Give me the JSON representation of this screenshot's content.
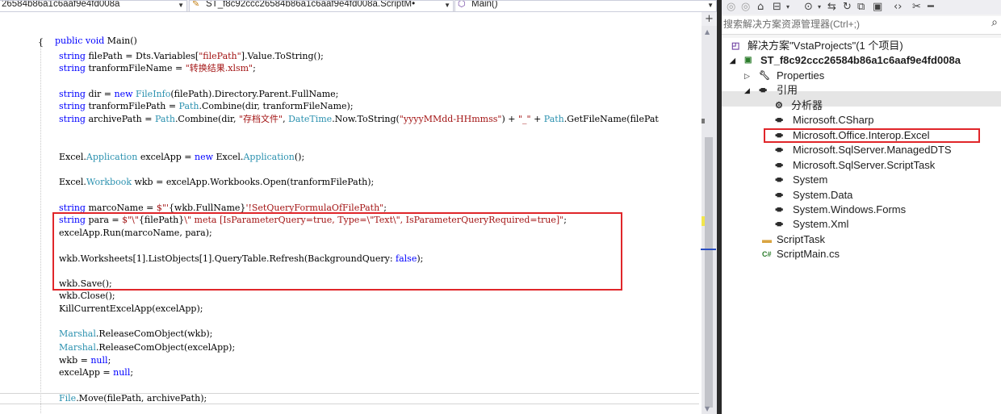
{
  "editor": {
    "nav": {
      "project_dropdown": "26584b86a1c6aaf9e4fd008a",
      "class_dropdown": "ST_f8c92ccc26584b86a1c6aaf9e4fd008a.ScriptM•",
      "member_dropdown": "Main()"
    },
    "code": {
      "l_main": "public void Main()",
      "l_brace": "{",
      "l_filepath": [
        {
          "t": "string",
          "c": "kw"
        },
        {
          "t": " filePath = Dts.Variables[",
          "c": "ip"
        },
        {
          "t": "\"filePath\"",
          "c": "st"
        },
        {
          "t": "].Value.ToString();",
          "c": "ip"
        }
      ],
      "l_tranformname": [
        {
          "t": "string",
          "c": "kw"
        },
        {
          "t": " tranformFileName = ",
          "c": "ip"
        },
        {
          "t": "\"转换结果.xlsm\"",
          "c": "st"
        },
        {
          "t": ";",
          "c": "ip"
        }
      ],
      "l_dir": [
        {
          "t": "string",
          "c": "kw"
        },
        {
          "t": " dir = ",
          "c": "ip"
        },
        {
          "t": "new",
          "c": "kw"
        },
        {
          "t": " ",
          "c": "ip"
        },
        {
          "t": "FileInfo",
          "c": "ty"
        },
        {
          "t": "(filePath).Directory.Parent.FullName;",
          "c": "ip"
        }
      ],
      "l_tranformpath": [
        {
          "t": "string",
          "c": "kw"
        },
        {
          "t": " tranformFilePath = ",
          "c": "ip"
        },
        {
          "t": "Path",
          "c": "ty"
        },
        {
          "t": ".Combine(dir, tranformFileName);",
          "c": "ip"
        }
      ],
      "l_archive": [
        {
          "t": "string",
          "c": "kw"
        },
        {
          "t": " archivePath = ",
          "c": "ip"
        },
        {
          "t": "Path",
          "c": "ty"
        },
        {
          "t": ".Combine(dir, ",
          "c": "ip"
        },
        {
          "t": "\"存档文件\"",
          "c": "st"
        },
        {
          "t": ", ",
          "c": "ip"
        },
        {
          "t": "DateTime",
          "c": "ty"
        },
        {
          "t": ".Now.ToString(",
          "c": "ip"
        },
        {
          "t": "\"yyyyMMdd-HHmmss\"",
          "c": "st"
        },
        {
          "t": ") + ",
          "c": "ip"
        },
        {
          "t": "\"_\"",
          "c": "st"
        },
        {
          "t": " + ",
          "c": "ip"
        },
        {
          "t": "Path",
          "c": "ty"
        },
        {
          "t": ".GetFileName(filePat",
          "c": "ip"
        }
      ],
      "l_excelapp": [
        {
          "t": "Excel.",
          "c": "ip"
        },
        {
          "t": "Application",
          "c": "ty"
        },
        {
          "t": " excelApp = ",
          "c": "ip"
        },
        {
          "t": "new",
          "c": "kw"
        },
        {
          "t": " Excel.",
          "c": "ip"
        },
        {
          "t": "Application",
          "c": "ty"
        },
        {
          "t": "();",
          "c": "ip"
        }
      ],
      "l_workbook": [
        {
          "t": "Excel.",
          "c": "ip"
        },
        {
          "t": "Workbook",
          "c": "ty"
        },
        {
          "t": " wkb = excelApp.Workbooks.Open(tranformFilePath);",
          "c": "ip"
        }
      ],
      "l_marco": [
        {
          "t": "string",
          "c": "kw"
        },
        {
          "t": " marcoName = ",
          "c": "ip"
        },
        {
          "t": "$\"'",
          "c": "st"
        },
        {
          "t": "{wkb.FullName}",
          "c": "ip"
        },
        {
          "t": "'!SetQueryFormulaOfFilePath\"",
          "c": "st"
        },
        {
          "t": ";",
          "c": "ip"
        }
      ],
      "l_para": [
        {
          "t": "string",
          "c": "kw"
        },
        {
          "t": " para = ",
          "c": "ip"
        },
        {
          "t": "$\"\\\"",
          "c": "st"
        },
        {
          "t": "{filePath}",
          "c": "ip"
        },
        {
          "t": "\\\" meta [IsParameterQuery=true, Type=\\\"Text\\\", IsParameterQueryRequired=true]\"",
          "c": "st"
        },
        {
          "t": ";",
          "c": "ip"
        }
      ],
      "l_run": [
        {
          "t": "excelApp.Run(marcoName, para);",
          "c": "ip"
        }
      ],
      "l_refresh": [
        {
          "t": "wkb.Worksheets[1].ListObjects[1].QueryTable.Refresh(BackgroundQuery: ",
          "c": "ip"
        },
        {
          "t": "false",
          "c": "kw"
        },
        {
          "t": ");",
          "c": "ip"
        }
      ],
      "l_save": [
        {
          "t": "wkb.Save();",
          "c": "ip"
        }
      ],
      "l_close": [
        {
          "t": "wkb.Close();",
          "c": "ip"
        }
      ],
      "l_kill": [
        {
          "t": "KillCurrentExcelApp(excelApp);",
          "c": "ip"
        }
      ],
      "l_release1": [
        {
          "t": "Marshal",
          "c": "ty"
        },
        {
          "t": ".ReleaseComObject(wkb);",
          "c": "ip"
        }
      ],
      "l_release2": [
        {
          "t": "Marshal",
          "c": "ty"
        },
        {
          "t": ".ReleaseComObject(excelApp);",
          "c": "ip"
        }
      ],
      "l_wkbnull": [
        {
          "t": "wkb = ",
          "c": "ip"
        },
        {
          "t": "null",
          "c": "kw"
        },
        {
          "t": ";",
          "c": "ip"
        }
      ],
      "l_appnull": [
        {
          "t": "excelApp = ",
          "c": "ip"
        },
        {
          "t": "null",
          "c": "kw"
        },
        {
          "t": ";",
          "c": "ip"
        }
      ],
      "l_move": [
        {
          "t": "File",
          "c": "ty"
        },
        {
          "t": ".Move(filePath, archivePath);",
          "c": "ip"
        }
      ]
    },
    "colors": {
      "keyword": "#0000ff",
      "type": "#2b91af",
      "string": "#a31515",
      "highlight": "#e0262a"
    }
  },
  "solution_explorer": {
    "search_placeholder": "搜索解决方案资源管理器(Ctrl+;)",
    "solution_label": "解决方案\"VstaProjects\"(1 个项目)",
    "project_label": "ST_f8c92ccc26584b86a1c6aaf9e4fd008a",
    "properties_label": "Properties",
    "references_label": "引用",
    "analyzers_label": "分析器",
    "references": [
      "Microsoft.CSharp",
      "Microsoft.Office.Interop.Excel",
      "Microsoft.SqlServer.ManagedDTS",
      "Microsoft.SqlServer.ScriptTask",
      "System",
      "System.Data",
      "System.Windows.Forms",
      "System.Xml"
    ],
    "folder_label": "ScriptTask",
    "file_label": "ScriptMain.cs"
  }
}
